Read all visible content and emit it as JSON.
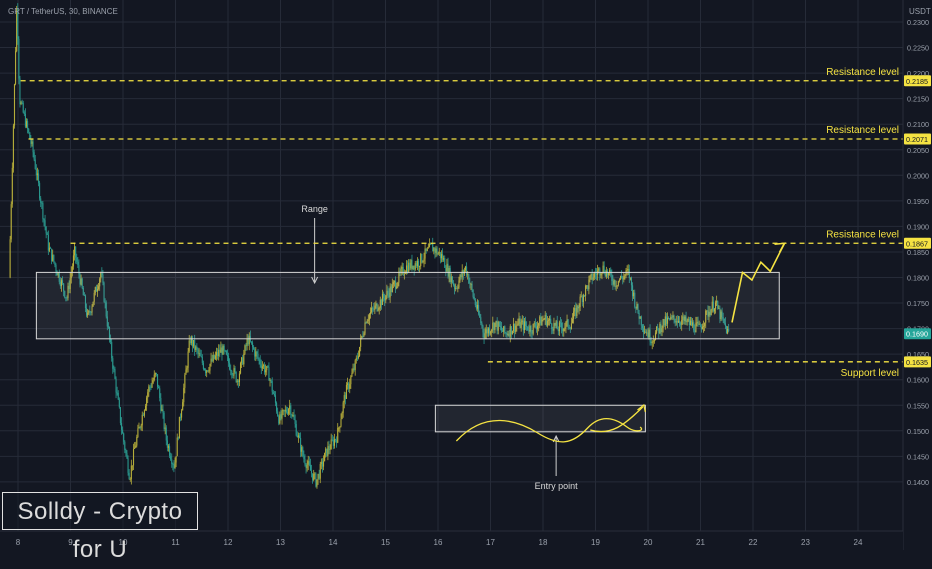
{
  "header": {
    "symbol_line": "GRT / TetherUS, 30, BINANCE"
  },
  "price_axis": {
    "unit_label": "USDT"
  },
  "watermark": {
    "text": "Solldy - Crypto for U"
  },
  "colors": {
    "background": "#131722",
    "grid": "#262b38",
    "candle_up": "#b6ad3a",
    "candle_down": "#2a9a8f",
    "level_line": "#f5e342",
    "box_border": "#d8d8d8",
    "axis_text": "#9aa0ab"
  },
  "chart_data": {
    "type": "candlestick",
    "x_axis_ticks": [
      "8",
      "9",
      "10",
      "11",
      "12",
      "13",
      "14",
      "15",
      "16",
      "17",
      "18",
      "19",
      "20",
      "21",
      "22",
      "23",
      "24"
    ],
    "y_axis_ticks": [
      0.14,
      0.145,
      0.15,
      0.155,
      0.16,
      0.165,
      0.17,
      0.175,
      0.18,
      0.185,
      0.19,
      0.195,
      0.2,
      0.205,
      0.21,
      0.215,
      0.22,
      0.225,
      0.23
    ],
    "ylim": [
      0.1375,
      0.2335
    ],
    "xlim": [
      7.8,
      25.3
    ],
    "price_path": [
      [
        7.85,
        0.18
      ],
      [
        8.0,
        0.234
      ],
      [
        8.05,
        0.215
      ],
      [
        8.3,
        0.205
      ],
      [
        8.6,
        0.186
      ],
      [
        8.95,
        0.176
      ],
      [
        9.1,
        0.185
      ],
      [
        9.35,
        0.172
      ],
      [
        9.6,
        0.181
      ],
      [
        9.8,
        0.165
      ],
      [
        10.0,
        0.15
      ],
      [
        10.15,
        0.141
      ],
      [
        10.25,
        0.147
      ],
      [
        10.5,
        0.158
      ],
      [
        10.65,
        0.161
      ],
      [
        10.85,
        0.148
      ],
      [
        11.0,
        0.143
      ],
      [
        11.1,
        0.152
      ],
      [
        11.3,
        0.168
      ],
      [
        11.6,
        0.162
      ],
      [
        11.9,
        0.166
      ],
      [
        12.2,
        0.16
      ],
      [
        12.4,
        0.168
      ],
      [
        12.6,
        0.164
      ],
      [
        12.8,
        0.161
      ],
      [
        13.0,
        0.152
      ],
      [
        13.2,
        0.155
      ],
      [
        13.45,
        0.145
      ],
      [
        13.7,
        0.14
      ],
      [
        13.9,
        0.146
      ],
      [
        14.1,
        0.149
      ],
      [
        14.25,
        0.157
      ],
      [
        14.45,
        0.163
      ],
      [
        14.65,
        0.172
      ],
      [
        14.9,
        0.175
      ],
      [
        15.15,
        0.178
      ],
      [
        15.4,
        0.182
      ],
      [
        15.65,
        0.183
      ],
      [
        15.9,
        0.186
      ],
      [
        16.1,
        0.184
      ],
      [
        16.35,
        0.178
      ],
      [
        16.55,
        0.182
      ],
      [
        16.7,
        0.176
      ],
      [
        16.9,
        0.169
      ],
      [
        17.1,
        0.171
      ],
      [
        17.3,
        0.169
      ],
      [
        17.55,
        0.171
      ],
      [
        17.8,
        0.17
      ],
      [
        18.05,
        0.172
      ],
      [
        18.3,
        0.17
      ],
      [
        18.55,
        0.171
      ],
      [
        18.75,
        0.176
      ],
      [
        18.95,
        0.18
      ],
      [
        19.15,
        0.182
      ],
      [
        19.4,
        0.179
      ],
      [
        19.65,
        0.181
      ],
      [
        19.8,
        0.174
      ],
      [
        19.95,
        0.17
      ],
      [
        20.1,
        0.168
      ],
      [
        20.3,
        0.171
      ],
      [
        20.55,
        0.172
      ],
      [
        20.8,
        0.171
      ],
      [
        21.0,
        0.17
      ],
      [
        21.15,
        0.173
      ],
      [
        21.3,
        0.175
      ],
      [
        21.42,
        0.172
      ],
      [
        21.55,
        0.169
      ]
    ],
    "horizontal_levels": [
      {
        "label": "Resistance level",
        "price": 0.2185,
        "price_tag": "0.2185",
        "from_x": 8.05
      },
      {
        "label": "Resistance level",
        "price": 0.2071,
        "price_tag": "0.2071",
        "from_x": 8.2
      },
      {
        "label": "Resistance level",
        "price": 0.1867,
        "price_tag": "0.1867",
        "from_x": 9.0
      },
      {
        "label": "Support level",
        "price": 0.1635,
        "price_tag": "0.1635",
        "from_x": 16.95
      }
    ],
    "current_price": {
      "price": 0.169,
      "price_tag": "0.1690"
    },
    "range_box": {
      "x0": 8.35,
      "x1": 22.5,
      "y0": 0.168,
      "y1": 0.181,
      "label": "Range"
    },
    "entry_box": {
      "x0": 15.95,
      "x1": 19.95,
      "y0": 0.1498,
      "y1": 0.155,
      "label": "Entry point"
    },
    "projection_path": [
      [
        21.6,
        0.1712
      ],
      [
        21.8,
        0.181
      ],
      [
        21.98,
        0.1795
      ],
      [
        22.15,
        0.183
      ],
      [
        22.33,
        0.1812
      ],
      [
        22.6,
        0.1867
      ]
    ]
  }
}
